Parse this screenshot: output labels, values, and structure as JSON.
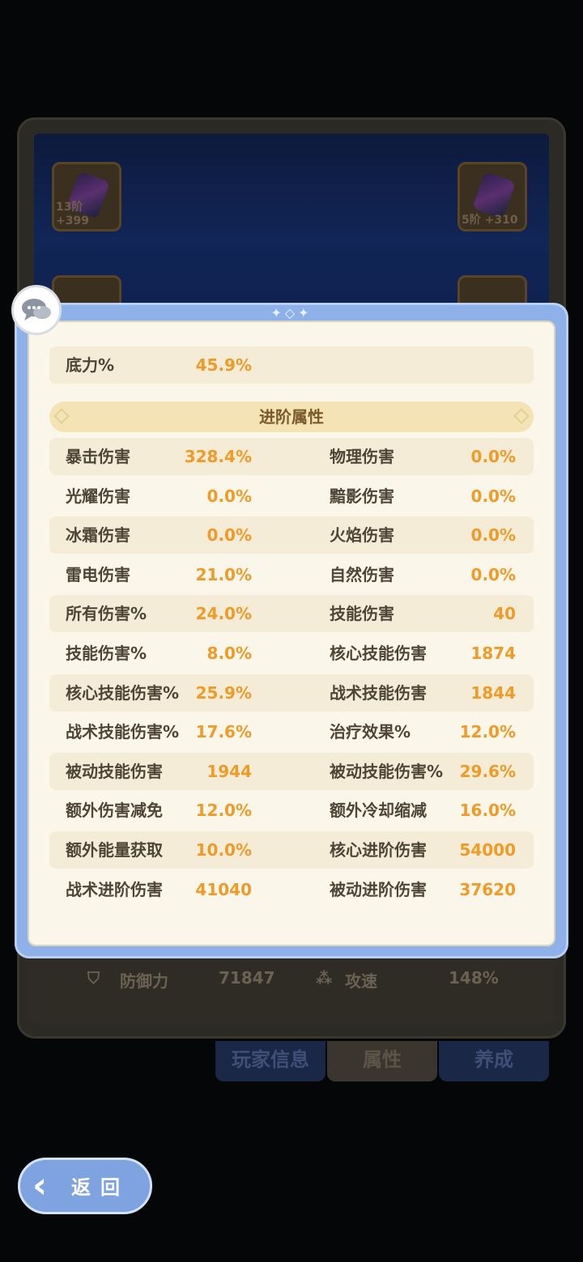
{
  "background": {
    "slots": [
      {
        "level_text": "13阶 +399"
      },
      {
        "level_text": "5阶 +310"
      }
    ],
    "stats": {
      "defense_label": "防御力",
      "defense_value": "71847",
      "speed_label": "攻速",
      "speed_value": "148%"
    },
    "tabs": [
      "玩家信息",
      "属性",
      "养成"
    ]
  },
  "panel": {
    "top_stat": {
      "label": "底力%",
      "value": "45.9%"
    },
    "section_title": "进阶属性",
    "rows": [
      {
        "l_label": "暴击伤害",
        "l_value": "328.4%",
        "r_label": "物理伤害",
        "r_value": "0.0%"
      },
      {
        "l_label": "光耀伤害",
        "l_value": "0.0%",
        "r_label": "黯影伤害",
        "r_value": "0.0%"
      },
      {
        "l_label": "冰霜伤害",
        "l_value": "0.0%",
        "r_label": "火焰伤害",
        "r_value": "0.0%"
      },
      {
        "l_label": "雷电伤害",
        "l_value": "21.0%",
        "r_label": "自然伤害",
        "r_value": "0.0%"
      },
      {
        "l_label": "所有伤害%",
        "l_value": "24.0%",
        "r_label": "技能伤害",
        "r_value": "40"
      },
      {
        "l_label": "技能伤害%",
        "l_value": "8.0%",
        "r_label": "核心技能伤害",
        "r_value": "1874"
      },
      {
        "l_label": "核心技能伤害%",
        "l_value": "25.9%",
        "r_label": "战术技能伤害",
        "r_value": "1844"
      },
      {
        "l_label": "战术技能伤害%",
        "l_value": "17.6%",
        "r_label": "治疗效果%",
        "r_value": "12.0%"
      },
      {
        "l_label": "被动技能伤害",
        "l_value": "1944",
        "r_label": "被动技能伤害%",
        "r_value": "29.6%"
      },
      {
        "l_label": "额外伤害减免",
        "l_value": "12.0%",
        "r_label": "额外冷却缩减",
        "r_value": "16.0%"
      },
      {
        "l_label": "额外能量获取",
        "l_value": "10.0%",
        "r_label": "核心进阶伤害",
        "r_value": "54000"
      },
      {
        "l_label": "战术进阶伤害",
        "l_value": "41040",
        "r_label": "被动进阶伤害",
        "r_value": "37620"
      }
    ]
  },
  "back_button": {
    "label": "返回"
  },
  "colors": {
    "panel_frame": "#8fb1ea",
    "panel_bg": "#faf6ea",
    "value_orange": "#f09a27",
    "label_brown": "#4e4536",
    "section_bg": "#f3e3b5"
  }
}
